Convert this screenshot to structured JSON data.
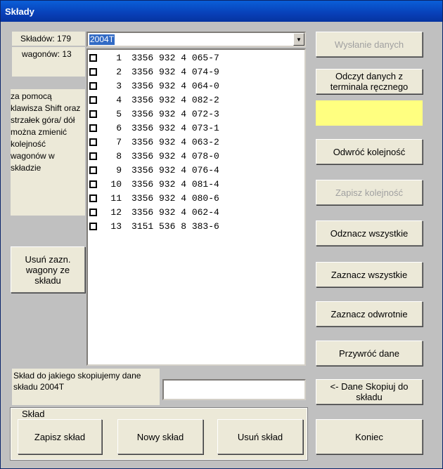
{
  "window": {
    "title": "Składy"
  },
  "left": {
    "skladow_label": "Składów: 179",
    "wagonow_label": "wagonów: 13",
    "hint": "za pomocą klawisza Shift oraz strzałek góra/ dół można zmienić kolejność wagonów w składzie",
    "remove_button": "Usuń zazn. wagony ze składu",
    "copy_label": "Skład do jakiego skopiujemy dane składu 2004T"
  },
  "combo": {
    "selected": "2004T"
  },
  "wagons": [
    {
      "n": "1",
      "code": "3356 932 4 065-7"
    },
    {
      "n": "2",
      "code": "3356 932 4 074-9"
    },
    {
      "n": "3",
      "code": "3356 932 4 064-0"
    },
    {
      "n": "4",
      "code": "3356 932 4 082-2"
    },
    {
      "n": "5",
      "code": "3356 932 4 072-3"
    },
    {
      "n": "6",
      "code": "3356 932 4 073-1"
    },
    {
      "n": "7",
      "code": "3356 932 4 063-2"
    },
    {
      "n": "8",
      "code": "3356 932 4 078-0"
    },
    {
      "n": "9",
      "code": "3356 932 4 076-4"
    },
    {
      "n": "10",
      "code": "3356 932 4 081-4"
    },
    {
      "n": "11",
      "code": "3356 932 4 080-6"
    },
    {
      "n": "12",
      "code": "3356 932 4 062-4"
    },
    {
      "n": "13",
      "code": "3151 536 8 383-6"
    }
  ],
  "group": {
    "legend": "Skład",
    "save": "Zapisz skład",
    "new": "Nowy skład",
    "delete": "Usuń skład"
  },
  "right": {
    "send": "Wysłanie danych",
    "read": "Odczyt danych z terminala ręcznego",
    "reverse": "Odwróć kolejność",
    "save_order": "Zapisz kolejność",
    "uncheck_all": "Odznacz wszystkie",
    "check_all": "Zaznacz wszystkie",
    "invert": "Zaznacz odwrotnie",
    "restore": "Przywróć dane",
    "copy": "<- Dane Skopiuj do składu",
    "end": "Koniec",
    "highlight_color": "#ffff80"
  }
}
